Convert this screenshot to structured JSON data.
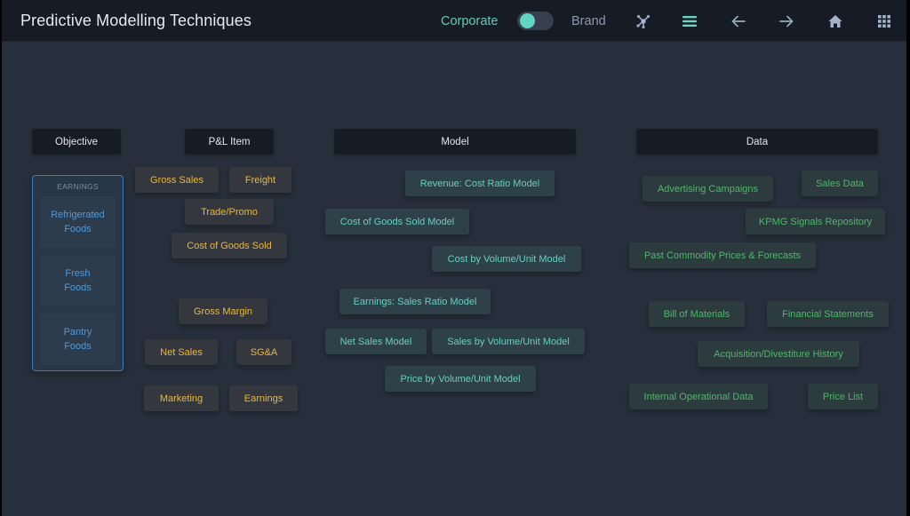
{
  "header": {
    "title": "Predictive Modelling Techniques",
    "toggle": {
      "left_label": "Corporate",
      "right_label": "Brand",
      "state": "Corporate"
    },
    "icons": [
      "network-icon",
      "menu-icon",
      "arrow-left-icon",
      "arrow-right-icon",
      "home-icon",
      "grid-icon"
    ]
  },
  "columns": {
    "objective": "Objective",
    "pl_item": "P&L Item",
    "model": "Model",
    "data": "Data"
  },
  "objective": {
    "group_label": "EARNINGS",
    "items": [
      "Refrigerated\nFoods",
      "Fresh\nFoods",
      "Pantry\nFoods"
    ]
  },
  "pl_items": [
    "Gross Sales",
    "Freight",
    "Trade/Promo",
    "Cost of Goods Sold",
    "Gross Margin",
    "Net Sales",
    "SG&A",
    "Marketing",
    "Earnings"
  ],
  "models": [
    "Revenue: Cost Ratio Model",
    "Cost of Goods Sold Model",
    "Cost by Volume/Unit Model",
    "Earnings: Sales Ratio Model",
    "Net Sales Model",
    "Sales by Volume/Unit Model",
    "Price by Volume/Unit Model"
  ],
  "data_sources": [
    "Advertising Campaigns",
    "Sales Data",
    "KPMG Signals Repository",
    "Past Commodity Prices & Forecasts",
    "Bill of Materials",
    "Financial Statements",
    "Acquisition/Divestiture History",
    "Internal Operational Data",
    "Price List"
  ],
  "colors": {
    "accent_teal": "#5fd7c2",
    "pl_gold": "#e9b73c",
    "model_teal": "#67cfc0",
    "data_green": "#4fb66a",
    "objective_blue": "#4a9be0"
  }
}
